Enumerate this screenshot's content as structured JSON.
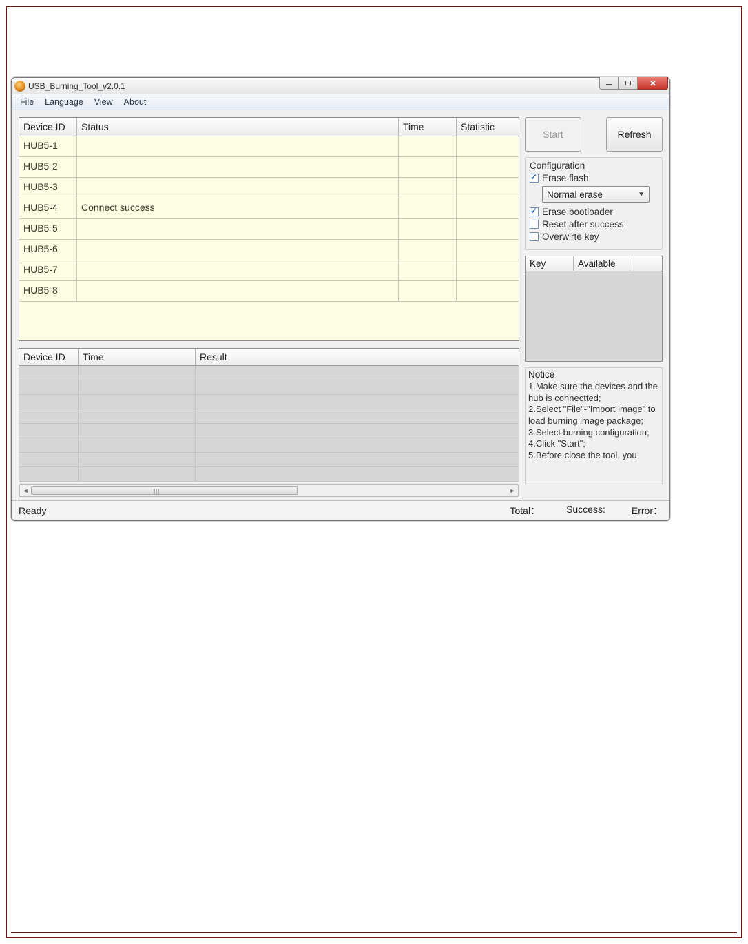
{
  "window": {
    "title": "USB_Burning_Tool_v2.0.1"
  },
  "menu": {
    "file": "File",
    "language": "Language",
    "view": "View",
    "about": "About"
  },
  "buttons": {
    "start": "Start",
    "refresh": "Refresh"
  },
  "deviceTable": {
    "headers": {
      "id": "Device ID",
      "status": "Status",
      "time": "Time",
      "statistic": "Statistic"
    },
    "rows": [
      {
        "id": "HUB5-1",
        "status": "",
        "time": "",
        "statistic": ""
      },
      {
        "id": "HUB5-2",
        "status": "",
        "time": "",
        "statistic": ""
      },
      {
        "id": "HUB5-3",
        "status": "",
        "time": "",
        "statistic": ""
      },
      {
        "id": "HUB5-4",
        "status": "Connect success",
        "time": "",
        "statistic": ""
      },
      {
        "id": "HUB5-5",
        "status": "",
        "time": "",
        "statistic": ""
      },
      {
        "id": "HUB5-6",
        "status": "",
        "time": "",
        "statistic": ""
      },
      {
        "id": "HUB5-7",
        "status": "",
        "time": "",
        "statistic": ""
      },
      {
        "id": "HUB5-8",
        "status": "",
        "time": "",
        "statistic": ""
      }
    ]
  },
  "resultTable": {
    "headers": {
      "id": "Device ID",
      "time": "Time",
      "result": "Result"
    },
    "rowCount": 8
  },
  "configuration": {
    "title": "Configuration",
    "eraseFlash": {
      "label": "Erase flash",
      "checked": true
    },
    "eraseMode": {
      "selected": "Normal erase"
    },
    "eraseBootloader": {
      "label": "Erase bootloader",
      "checked": true
    },
    "resetAfterSuccess": {
      "label": "Reset after success",
      "checked": false
    },
    "overwriteKey": {
      "label": "Overwirte key",
      "checked": false
    }
  },
  "keyTable": {
    "headers": {
      "key": "Key",
      "available": "Available"
    }
  },
  "notice": {
    "title": "Notice",
    "body": "1.Make sure the devices and the hub is connectted;\n2.Select \"File\"-\"Import image\" to load burning image package;\n3.Select burning configuration;\n4.Click \"Start\";\n5.Before close the tool, you"
  },
  "statusbar": {
    "ready": "Ready",
    "total": "Total：",
    "success": "Success:",
    "error": "Error："
  }
}
